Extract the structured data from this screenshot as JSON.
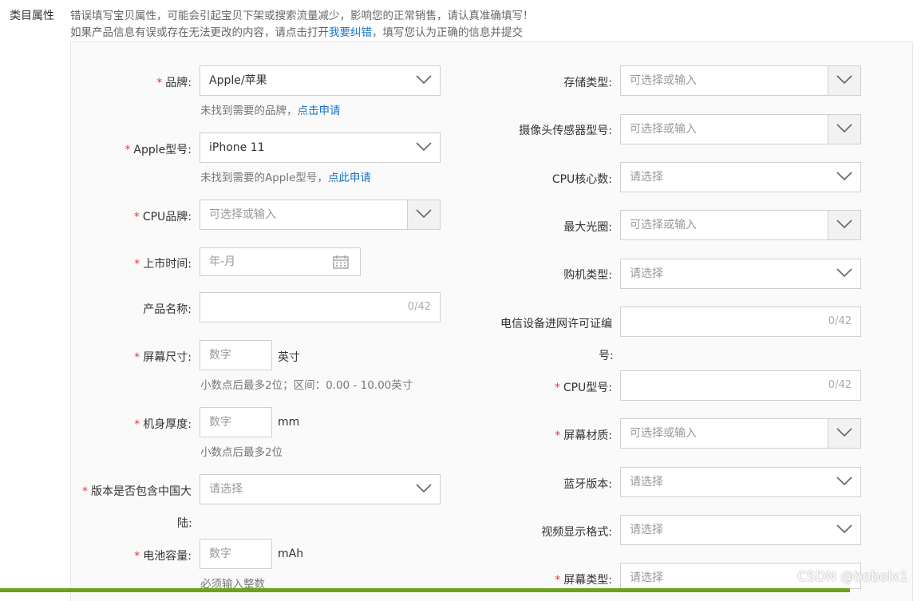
{
  "section_label": "类目属性",
  "notice": {
    "line1": "错误填写宝贝属性，可能会引起宝贝下架或搜索流量减少，影响您的正常销售，请认真准确填写！",
    "line2_prefix": "如果产品信息有误或存在无法更改的内容，请点击打开",
    "line2_link": "我要纠错",
    "line2_suffix": "，填写您认为正确的信息并提交"
  },
  "required_mark": "*",
  "left": {
    "brand": {
      "label": "品牌:",
      "value": "Apple/苹果",
      "hint": "未找到需要的品牌，",
      "hint_link": "点击申请"
    },
    "model": {
      "label": "Apple型号:",
      "value": "iPhone 11",
      "hint": "未找到需要的Apple型号，",
      "hint_link": "点此申请"
    },
    "cpu_brand": {
      "label": "CPU品牌:",
      "placeholder": "可选择或输入"
    },
    "launch_date": {
      "label": "上市时间:",
      "placeholder": "年-月"
    },
    "product_name": {
      "label": "产品名称:",
      "counter": "0/42"
    },
    "screen_size": {
      "label": "屏幕尺寸:",
      "placeholder": "数字",
      "unit": "英寸",
      "hint": "小数点后最多2位；区间：0.00 - 10.00英寸"
    },
    "thickness": {
      "label": "机身厚度:",
      "placeholder": "数字",
      "unit": "mm",
      "hint": "小数点后最多2位"
    },
    "mainland": {
      "label_line1": "版本是否包含中国大",
      "label_line2": "陆:",
      "placeholder": "请选择"
    },
    "battery": {
      "label": "电池容量:",
      "placeholder": "数字",
      "unit": "mAh",
      "hint": "必须输入整数"
    }
  },
  "right": {
    "storage_type": {
      "label": "存储类型:",
      "placeholder": "可选择或输入"
    },
    "camera_sensor": {
      "label": "摄像头传感器型号:",
      "placeholder": "可选择或输入"
    },
    "cpu_cores": {
      "label": "CPU核心数:",
      "placeholder": "请选择"
    },
    "max_aperture": {
      "label": "最大光圈:",
      "placeholder": "可选择或输入"
    },
    "purchase_type": {
      "label": "购机类型:",
      "placeholder": "请选择"
    },
    "telecom_license": {
      "label_line1": "电信设备进网许可证编",
      "label_line2": "号:",
      "counter": "0/42"
    },
    "cpu_model": {
      "label": "CPU型号:",
      "counter": "0/42"
    },
    "screen_material": {
      "label": "屏幕材质:",
      "placeholder": "可选择或输入"
    },
    "bluetooth": {
      "label": "蓝牙版本:",
      "placeholder": "请选择"
    },
    "video_format": {
      "label": "视频显示格式:",
      "placeholder": "请选择"
    },
    "screen_type": {
      "label": "屏幕类型:",
      "placeholder": "请选择"
    }
  },
  "watermark": "CSDN @bobolx1",
  "colors": {
    "required": "#e4393c",
    "link": "#1a74c7",
    "bottom_bar": "#6ca31a"
  }
}
